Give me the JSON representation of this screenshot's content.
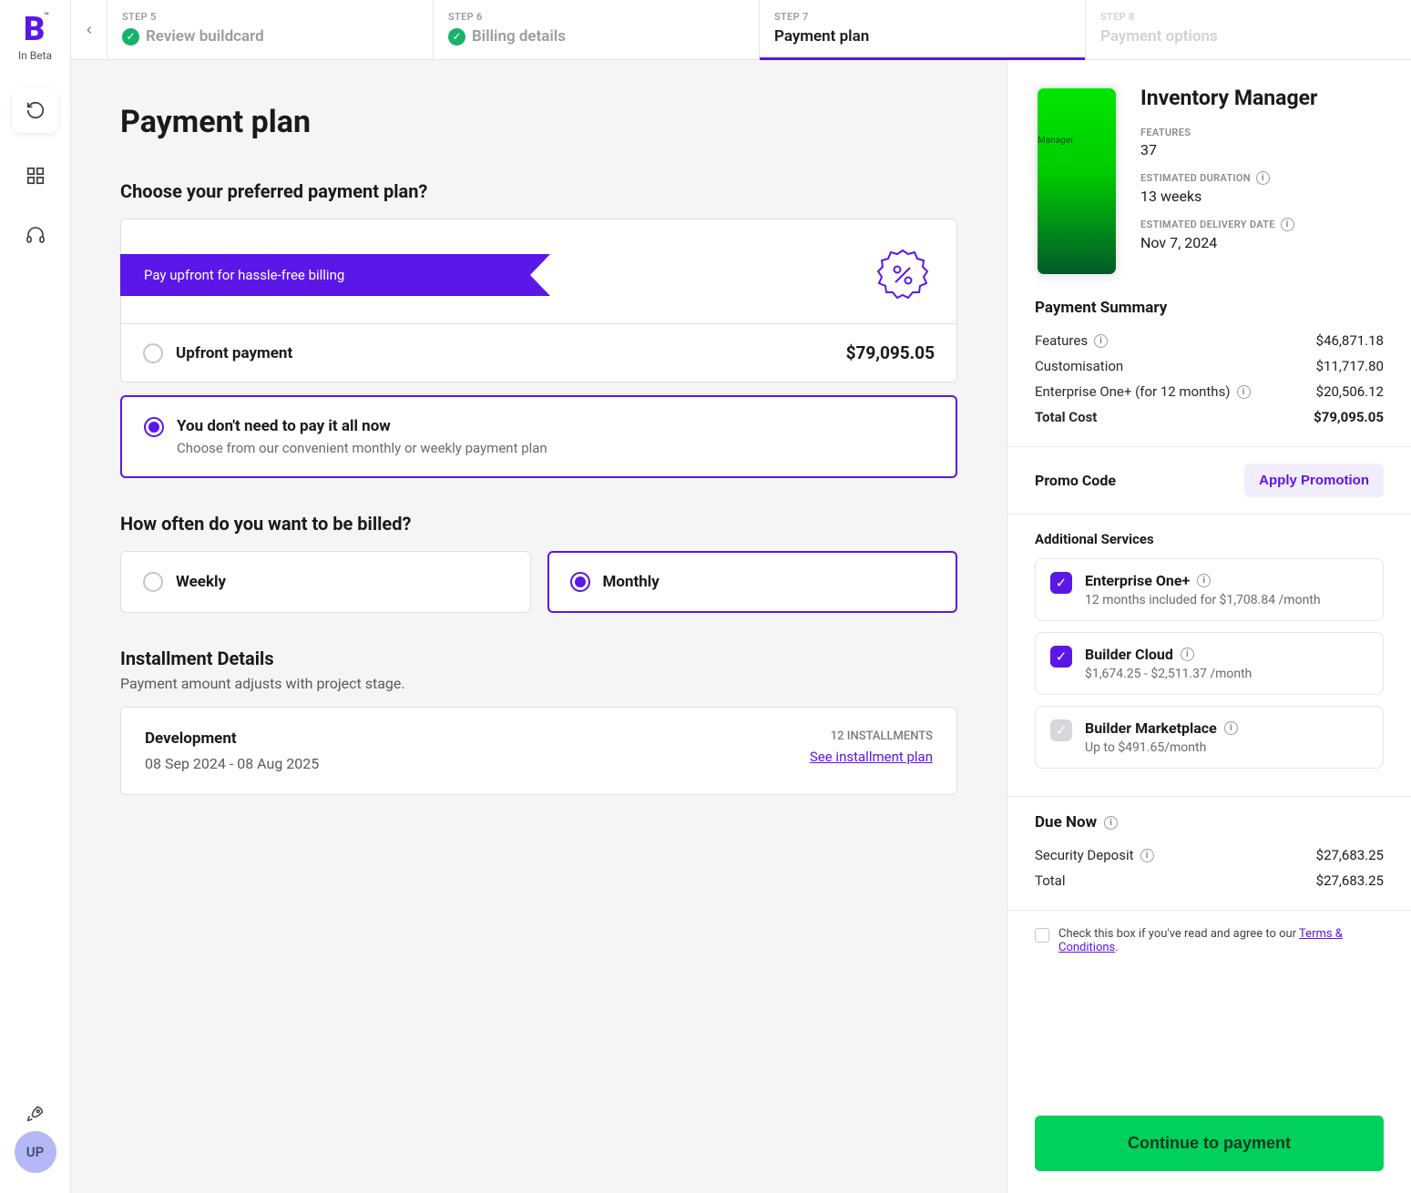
{
  "brand": {
    "logo": "B",
    "tm": "™",
    "sub": "In Beta"
  },
  "avatar": "UP",
  "steps": [
    {
      "num": "STEP 5",
      "title": "Review buildcard",
      "done": true
    },
    {
      "num": "STEP 6",
      "title": "Billing details",
      "done": true
    },
    {
      "num": "STEP 7",
      "title": "Payment plan",
      "active": true
    },
    {
      "num": "STEP 8",
      "title": "Payment options",
      "disabled": true
    }
  ],
  "page": {
    "title": "Payment plan",
    "choose_heading": "Choose your preferred payment plan?",
    "ribbon": "Pay upfront for hassle-free billing",
    "upfront": {
      "label": "Upfront payment",
      "price": "$79,095.05"
    },
    "flex": {
      "title": "You don't need to pay it all now",
      "sub": "Choose from our convenient monthly or weekly payment plan"
    },
    "freq_heading": "How often do you want to be billed?",
    "weekly": "Weekly",
    "monthly": "Monthly",
    "inst_heading": "Installment Details",
    "inst_sub": "Payment amount adjusts with project stage.",
    "inst": {
      "phase": "Development",
      "dates": "08 Sep 2024 - 08 Aug 2025",
      "count": "12 INSTALLMENTS",
      "link": "See installment plan"
    }
  },
  "summary": {
    "project": "Inventory Manager",
    "preview_label": "Manager",
    "features_label": "FEATURES",
    "features": "37",
    "duration_label": "ESTIMATED DURATION",
    "duration": "13 weeks",
    "delivery_label": "ESTIMATED DELIVERY DATE",
    "delivery": "Nov 7, 2024",
    "pay_heading": "Payment Summary",
    "lines": {
      "features": {
        "label": "Features",
        "val": "$46,871.18"
      },
      "custom": {
        "label": "Customisation",
        "val": "$11,717.80"
      },
      "ent": {
        "label": "Enterprise One+ (for 12 months)",
        "val": "$20,506.12"
      },
      "total": {
        "label": "Total Cost",
        "val": "$79,095.05"
      }
    },
    "promo_label": "Promo Code",
    "promo_btn": "Apply Promotion",
    "addl_heading": "Additional Services",
    "services": {
      "ent": {
        "title": "Enterprise One+",
        "sub": "12 months included for $1,708.84 /month",
        "checked": true
      },
      "cloud": {
        "title": "Builder Cloud",
        "sub": "$1,674.25 - $2,511.37 /month",
        "checked": true
      },
      "mkt": {
        "title": "Builder Marketplace",
        "sub": "Up to $491.65/month",
        "checked": false
      }
    },
    "due_heading": "Due Now",
    "due": {
      "deposit": {
        "label": "Security Deposit",
        "val": "$27,683.25"
      },
      "total": {
        "label": "Total",
        "val": "$27,683.25"
      }
    },
    "terms_prefix": "Check this box if you've read and agree to our ",
    "terms_link": "Terms & Conditions",
    "cta": "Continue to payment"
  }
}
